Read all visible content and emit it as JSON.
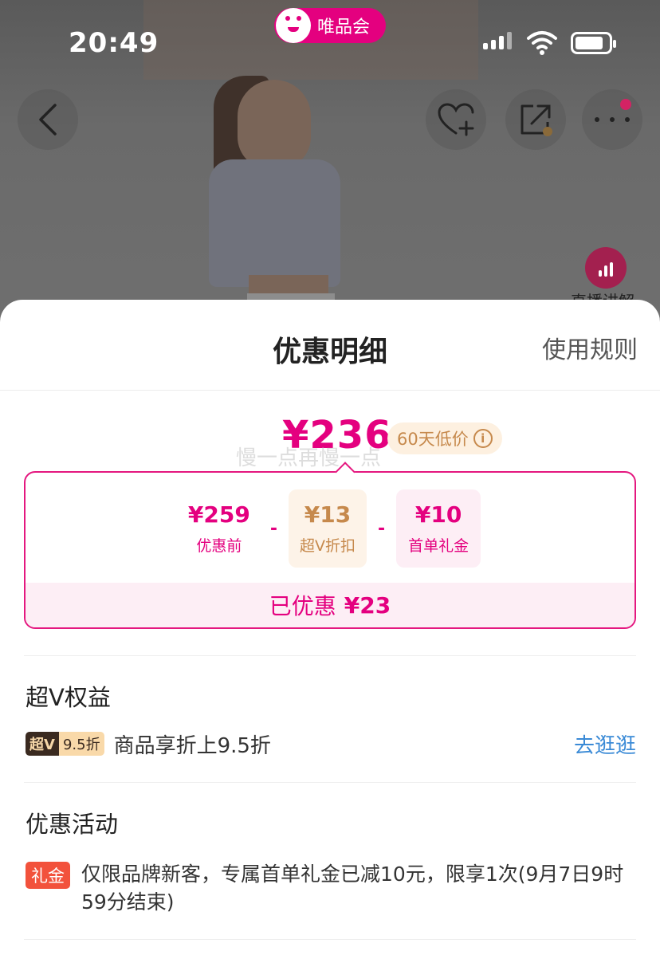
{
  "status_bar": {
    "time": "20:49",
    "app_name": "唯品会"
  },
  "nav": {
    "back_icon": "chevron-left-icon",
    "favorite_icon": "heart-plus-icon",
    "share_icon": "share-icon",
    "more_icon": "more-icon",
    "live_label": "直播讲解"
  },
  "sheet": {
    "title": "优惠明细",
    "rules_link": "使用规则",
    "final_price": "¥236",
    "low_price_badge": "60天低价",
    "watermark": "慢一点再慢一点",
    "breakdown": {
      "original": {
        "amount": "¥259",
        "label": "优惠前"
      },
      "sep1": "-",
      "vip_discount": {
        "amount": "¥13",
        "label": "超V折扣"
      },
      "sep2": "-",
      "first_order": {
        "amount": "¥10",
        "label": "首单礼金"
      },
      "saved_label": "已优惠",
      "saved_amount": "¥23"
    },
    "vip_section": {
      "title": "超V权益",
      "tag_left": "超V",
      "tag_right": "9.5折",
      "text": "商品享折上9.5折",
      "link": "去逛逛"
    },
    "promo_section": {
      "title": "优惠活动",
      "tag": "礼金",
      "text": "仅限品牌新客，专属首单礼金已减10元，限享1次(9月7日9时59分结束)"
    }
  },
  "colors": {
    "accent": "#e4007f",
    "gold": "#c6894c",
    "link": "#3a8ad6",
    "gift_tag": "#f2523c"
  }
}
